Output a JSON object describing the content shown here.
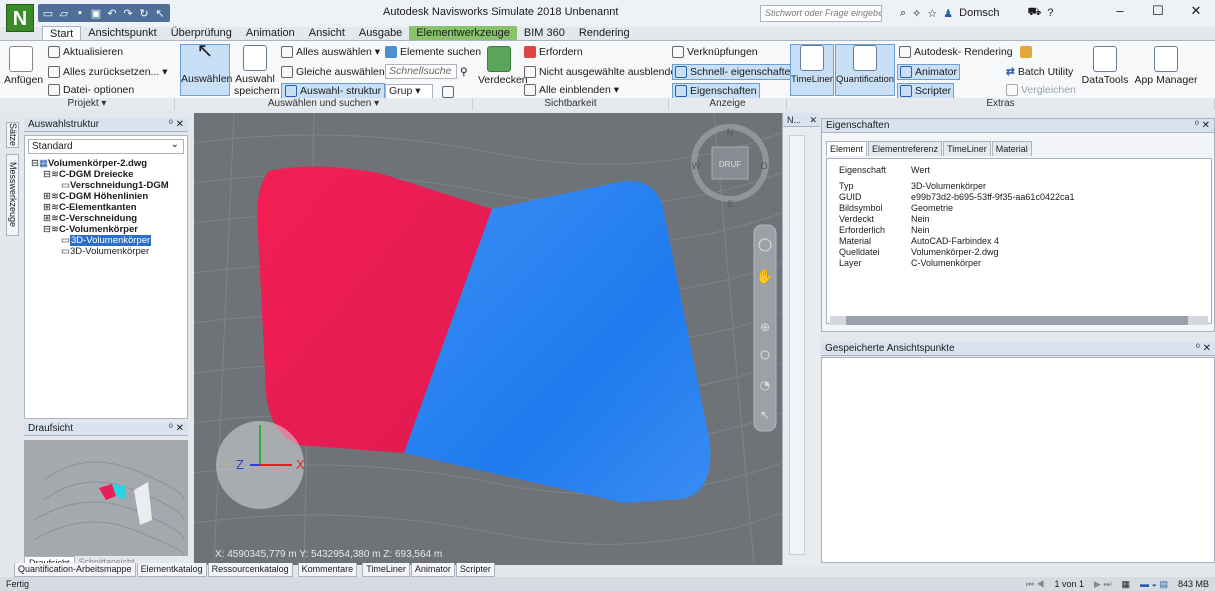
{
  "window": {
    "title": "Autodesk Navisworks Simulate 2018   Unbenannt",
    "search_placeholder": "Stichwort oder Frage eingeben",
    "user": "Domsch",
    "app_logo": "N"
  },
  "tabs": [
    "Start",
    "Ansichtspunkt",
    "Überprüfung",
    "Animation",
    "Ansicht",
    "Ausgabe",
    "Elementwerkzeuge",
    "BIM 360",
    "Rendering"
  ],
  "ribbon": {
    "projekt": {
      "label": "Projekt ▾",
      "anfuegen": "Anfügen",
      "aktualisieren": "Aktualisieren",
      "zuruecksetzen": "Alles zurücksetzen... ▾",
      "optionen": "Datei- optionen"
    },
    "auswahl": {
      "label": "Auswählen und suchen ▾",
      "auswaehlen": "Auswählen",
      "auswahl_speichern_1": "Auswahl",
      "auswahl_speichern_2": "speichern",
      "alles_auswaehlen": "Alles auswählen ▾",
      "gleiche_auswaehlen": "Gleiche auswählen ▾",
      "auswahlstruktur": "Auswahl- struktur",
      "elemente_suchen": "Elemente suchen",
      "schnellsuche": "Schnellsuche",
      "grup": "Grup ▾"
    },
    "sichtbarkeit": {
      "label": "Sichtbarkeit",
      "verdecken": "Verdecken",
      "erfordern": "Erfordern",
      "nicht_ausgewaehlte": "Nicht ausgewählte ausblenden",
      "alle_einblenden": "Alle einblenden ▾"
    },
    "anzeige": {
      "label": "Anzeige",
      "verknuepfungen": "Verknüpfungen",
      "schnell": "Schnell- eigenschaften",
      "eigenschaften": "Eigenschaften"
    },
    "extras": {
      "label": "Extras",
      "timeliner": "TimeLiner",
      "quantification": "Quantification",
      "autodesk_rendering": "Autodesk- Rendering",
      "animator": "Animator",
      "scripter": "Scripter",
      "batch": "Batch Utility",
      "vergleichen": "Vergleichen",
      "datatools": "DataTools",
      "appmanager": "App Manager"
    }
  },
  "left_tabs": [
    "Sätze",
    "Messwerkzeuge"
  ],
  "selection_tree": {
    "title": "Auswahlstruktur",
    "dropdown": "Standard",
    "items": [
      "Volumenkörper-2.dwg",
      "C-DGM Dreiecke",
      "Verschneidung1-DGM",
      "C-DGM Höhenlinien",
      "C-Elementkanten",
      "C-Verschneidung",
      "C-Volumenkörper",
      "3D-Volumenkörper",
      "3D-Volumenkörper"
    ]
  },
  "plan_view": {
    "title": "Draufsicht",
    "tabs": [
      "Draufsicht",
      "Schnittansicht"
    ]
  },
  "viewport": {
    "coords": "X: 4590345,779 m  Y: 5432954,380 m  Z: 693,564 m",
    "compass_n": "N",
    "compass_s": "S",
    "compass_w": "W",
    "compass_e": "O",
    "compass_center": "DRUF",
    "axis_x": "X",
    "axis_z": "Z"
  },
  "nav_panel_title": "N...",
  "properties": {
    "title": "Eigenschaften",
    "tabs": [
      "Element",
      "Elementreferenz",
      "TimeLiner",
      "Material"
    ],
    "header": [
      "Eigenschaft",
      "Wert"
    ],
    "rows": [
      [
        "Typ",
        "3D-Volumenkörper"
      ],
      [
        "GUID",
        "e99b73d2-b695-53ff-9f35-aa61c0422ca1"
      ],
      [
        "Bildsymbol",
        "Geometrie"
      ],
      [
        "Verdeckt",
        "Nein"
      ],
      [
        "Erforderlich",
        "Nein"
      ],
      [
        "Material",
        "AutoCAD-Farbindex 4"
      ],
      [
        "Quelldatei",
        "Volumenkörper-2.dwg"
      ],
      [
        "Layer",
        "C-Volumenkörper"
      ]
    ]
  },
  "saved_views": {
    "title": "Gespeicherte Ansichtspunkte"
  },
  "bottom_tabs": [
    "Quantification-Arbeitsmappe",
    "Elementkatalog",
    "Ressourcenkatalog",
    "Kommentare",
    "TimeLiner",
    "Animator",
    "Scripter"
  ],
  "status": {
    "text": "Fertig",
    "page": "1 von 1",
    "memory": "843 MB"
  },
  "colors": {
    "red_solid": "#ec1e57",
    "blue_solid": "#2e86f2",
    "viewport_bg": "#6f7378",
    "special_tab": "#88c36b"
  }
}
